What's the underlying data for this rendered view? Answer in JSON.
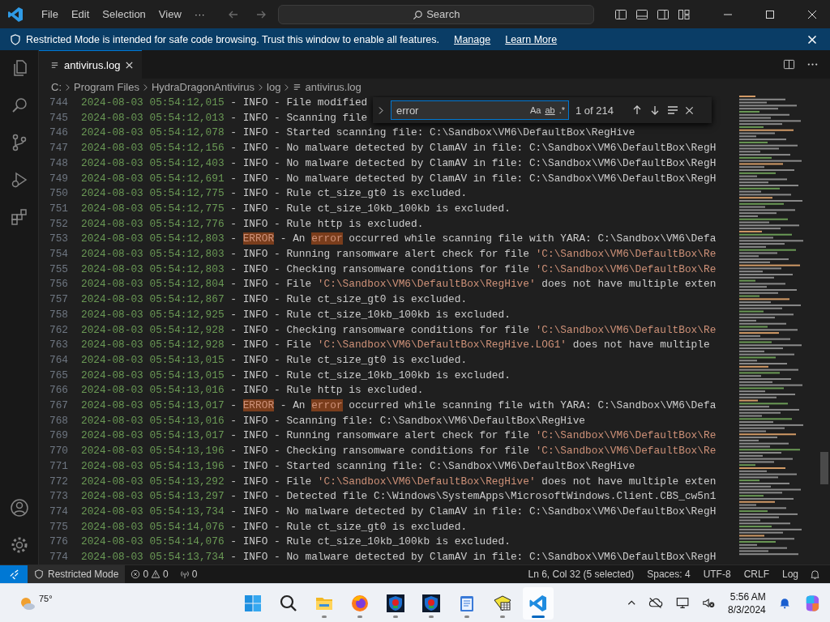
{
  "menu": [
    "File",
    "Edit",
    "Selection",
    "View",
    "···"
  ],
  "search": {
    "placeholder": "Search"
  },
  "banner": {
    "text": "Restricted Mode is intended for safe code browsing. Trust this window to enable all features.",
    "links": [
      "Manage",
      "Learn More"
    ]
  },
  "tabs": [
    {
      "label": "antivirus.log",
      "selected": true
    }
  ],
  "breadcrumb": [
    "C:",
    "Program Files",
    "HydraDragonAntivirus",
    "log",
    "antivirus.log"
  ],
  "find": {
    "value": "error",
    "options": [
      "Aa",
      "ab",
      ".*"
    ],
    "count": "1 of 214"
  },
  "lines": [
    {
      "number": "744",
      "segments": [
        {
          "kind": "time",
          "text": "2024-08-03 05:54:12,015"
        },
        {
          "kind": "plain",
          "text": " - INFO - File modified"
        }
      ]
    },
    {
      "number": "745",
      "segments": [
        {
          "kind": "time",
          "text": "2024-08-03 05:54:12,013"
        },
        {
          "kind": "plain",
          "text": " - INFO - Scanning file"
        }
      ]
    },
    {
      "number": "746",
      "segments": [
        {
          "kind": "time",
          "text": "2024-08-03 05:54:12,078"
        },
        {
          "kind": "plain",
          "text": " - INFO - Started scanning file: C:\\Sandbox\\VM6\\DefaultBox\\RegHive"
        }
      ]
    },
    {
      "number": "747",
      "segments": [
        {
          "kind": "time",
          "text": "2024-08-03 05:54:12,156"
        },
        {
          "kind": "plain",
          "text": " - INFO - No malware detected by ClamAV in file: C:\\Sandbox\\VM6\\DefaultBox\\RegH"
        }
      ]
    },
    {
      "number": "748",
      "segments": [
        {
          "kind": "time",
          "text": "2024-08-03 05:54:12,403"
        },
        {
          "kind": "plain",
          "text": " - INFO - No malware detected by ClamAV in file: C:\\Sandbox\\VM6\\DefaultBox\\RegH"
        }
      ]
    },
    {
      "number": "749",
      "segments": [
        {
          "kind": "time",
          "text": "2024-08-03 05:54:12,691"
        },
        {
          "kind": "plain",
          "text": " - INFO - No malware detected by ClamAV in file: C:\\Sandbox\\VM6\\DefaultBox\\RegH"
        }
      ]
    },
    {
      "number": "750",
      "segments": [
        {
          "kind": "time",
          "text": "2024-08-03 05:54:12,775"
        },
        {
          "kind": "plain",
          "text": " - INFO - Rule ct_size_gt0 is excluded."
        }
      ]
    },
    {
      "number": "751",
      "segments": [
        {
          "kind": "time",
          "text": "2024-08-03 05:54:12,775"
        },
        {
          "kind": "plain",
          "text": " - INFO - Rule ct_size_10kb_100kb is excluded."
        }
      ]
    },
    {
      "number": "752",
      "segments": [
        {
          "kind": "time",
          "text": "2024-08-03 05:54:12,776"
        },
        {
          "kind": "plain",
          "text": " - INFO - Rule http is excluded."
        }
      ]
    },
    {
      "number": "753",
      "segments": [
        {
          "kind": "time",
          "text": "2024-08-03 05:54:12,803"
        },
        {
          "kind": "plain",
          "text": " - "
        },
        {
          "kind": "match",
          "text": "ERROR"
        },
        {
          "kind": "plain",
          "text": " - An "
        },
        {
          "kind": "match",
          "text": "error"
        },
        {
          "kind": "plain",
          "text": " occurred while scanning file with YARA: C:\\Sandbox\\VM6\\Defa"
        }
      ]
    },
    {
      "number": "754",
      "segments": [
        {
          "kind": "time",
          "text": "2024-08-03 05:54:12,803"
        },
        {
          "kind": "plain",
          "text": " - INFO - Running ransomware alert check for file "
        },
        {
          "kind": "string",
          "text": "'C:\\Sandbox\\VM6\\DefaultBox\\Re"
        }
      ]
    },
    {
      "number": "755",
      "segments": [
        {
          "kind": "time",
          "text": "2024-08-03 05:54:12,803"
        },
        {
          "kind": "plain",
          "text": " - INFO - Checking ransomware conditions for file "
        },
        {
          "kind": "string",
          "text": "'C:\\Sandbox\\VM6\\DefaultBox\\Re"
        }
      ]
    },
    {
      "number": "756",
      "segments": [
        {
          "kind": "time",
          "text": "2024-08-03 05:54:12,804"
        },
        {
          "kind": "plain",
          "text": " - INFO - File "
        },
        {
          "kind": "string",
          "text": "'C:\\Sandbox\\VM6\\DefaultBox\\RegHive'"
        },
        {
          "kind": "plain",
          "text": " does not have multiple exten"
        }
      ]
    },
    {
      "number": "757",
      "segments": [
        {
          "kind": "time",
          "text": "2024-08-03 05:54:12,867"
        },
        {
          "kind": "plain",
          "text": " - INFO - Rule ct_size_gt0 is excluded."
        }
      ]
    },
    {
      "number": "758",
      "segments": [
        {
          "kind": "time",
          "text": "2024-08-03 05:54:12,925"
        },
        {
          "kind": "plain",
          "text": " - INFO - Rule ct_size_10kb_100kb is excluded."
        }
      ]
    },
    {
      "number": "762",
      "segments": [
        {
          "kind": "time",
          "text": "2024-08-03 05:54:12,928"
        },
        {
          "kind": "plain",
          "text": " - INFO - Checking ransomware conditions for file "
        },
        {
          "kind": "string",
          "text": "'C:\\Sandbox\\VM6\\DefaultBox\\Re"
        }
      ]
    },
    {
      "number": "763",
      "segments": [
        {
          "kind": "time",
          "text": "2024-08-03 05:54:12,928"
        },
        {
          "kind": "plain",
          "text": " - INFO - File "
        },
        {
          "kind": "string",
          "text": "'C:\\Sandbox\\VM6\\DefaultBox\\RegHive.LOG1'"
        },
        {
          "kind": "plain",
          "text": " does not have multiple"
        }
      ]
    },
    {
      "number": "764",
      "segments": [
        {
          "kind": "time",
          "text": "2024-08-03 05:54:13,015"
        },
        {
          "kind": "plain",
          "text": " - INFO - Rule ct_size_gt0 is excluded."
        }
      ]
    },
    {
      "number": "765",
      "segments": [
        {
          "kind": "time",
          "text": "2024-08-03 05:54:13,015"
        },
        {
          "kind": "plain",
          "text": " - INFO - Rule ct_size_10kb_100kb is excluded."
        }
      ]
    },
    {
      "number": "766",
      "segments": [
        {
          "kind": "time",
          "text": "2024-08-03 05:54:13,016"
        },
        {
          "kind": "plain",
          "text": " - INFO - Rule http is excluded."
        }
      ]
    },
    {
      "number": "767",
      "segments": [
        {
          "kind": "time",
          "text": "2024-08-03 05:54:13,017"
        },
        {
          "kind": "plain",
          "text": " - "
        },
        {
          "kind": "match",
          "text": "ERROR"
        },
        {
          "kind": "plain",
          "text": " - An "
        },
        {
          "kind": "match",
          "text": "error"
        },
        {
          "kind": "plain",
          "text": " occurred while scanning file with YARA: C:\\Sandbox\\VM6\\Defa"
        }
      ]
    },
    {
      "number": "768",
      "segments": [
        {
          "kind": "time",
          "text": "2024-08-03 05:54:13,016"
        },
        {
          "kind": "plain",
          "text": " - INFO - Scanning file: C:\\Sandbox\\VM6\\DefaultBox\\RegHive"
        }
      ]
    },
    {
      "number": "769",
      "segments": [
        {
          "kind": "time",
          "text": "2024-08-03 05:54:13,017"
        },
        {
          "kind": "plain",
          "text": " - INFO - Running ransomware alert check for file "
        },
        {
          "kind": "string",
          "text": "'C:\\Sandbox\\VM6\\DefaultBox\\Re"
        }
      ]
    },
    {
      "number": "770",
      "segments": [
        {
          "kind": "time",
          "text": "2024-08-03 05:54:13,196"
        },
        {
          "kind": "plain",
          "text": " - INFO - Checking ransomware conditions for file "
        },
        {
          "kind": "string",
          "text": "'C:\\Sandbox\\VM6\\DefaultBox\\Re"
        }
      ]
    },
    {
      "number": "771",
      "segments": [
        {
          "kind": "time",
          "text": "2024-08-03 05:54:13,196"
        },
        {
          "kind": "plain",
          "text": " - INFO - Started scanning file: C:\\Sandbox\\VM6\\DefaultBox\\RegHive"
        }
      ]
    },
    {
      "number": "772",
      "segments": [
        {
          "kind": "time",
          "text": "2024-08-03 05:54:13,292"
        },
        {
          "kind": "plain",
          "text": " - INFO - File "
        },
        {
          "kind": "string",
          "text": "'C:\\Sandbox\\VM6\\DefaultBox\\RegHive'"
        },
        {
          "kind": "plain",
          "text": " does not have multiple exten"
        }
      ]
    },
    {
      "number": "773",
      "segments": [
        {
          "kind": "time",
          "text": "2024-08-03 05:54:13,297"
        },
        {
          "kind": "plain",
          "text": " - INFO - Detected file C:\\Windows\\SystemApps\\MicrosoftWindows.Client.CBS_cw5n1"
        }
      ]
    },
    {
      "number": "774",
      "segments": [
        {
          "kind": "time",
          "text": "2024-08-03 05:54:13,734"
        },
        {
          "kind": "plain",
          "text": " - INFO - No malware detected by ClamAV in file: C:\\Sandbox\\VM6\\DefaultBox\\RegH"
        }
      ]
    },
    {
      "number": "775",
      "segments": [
        {
          "kind": "time",
          "text": "2024-08-03 05:54:14,076"
        },
        {
          "kind": "plain",
          "text": " - INFO - Rule ct_size_gt0 is excluded."
        }
      ]
    },
    {
      "number": "776",
      "segments": [
        {
          "kind": "time",
          "text": "2024-08-03 05:54:14,076"
        },
        {
          "kind": "plain",
          "text": " - INFO - Rule ct_size_10kb_100kb is excluded."
        }
      ]
    },
    {
      "number": "774",
      "segments": [
        {
          "kind": "time",
          "text": "2024-08-03 05:54:13,734"
        },
        {
          "kind": "plain",
          "text": " - INFO - No malware detected by ClamAV in file: C:\\Sandbox\\VM6\\DefaultBox\\RegH"
        }
      ]
    }
  ],
  "status_bar": {
    "restricted": "Restricted Mode",
    "errors": "0",
    "warnings": "0",
    "ports": "0",
    "items": [
      "Ln 6, Col 32 (5 selected)",
      "Spaces: 4",
      "UTF-8",
      "CRLF",
      "Log"
    ]
  },
  "taskbar": {
    "weather": "75°",
    "apps": [
      {
        "kind": "start",
        "active": false
      },
      {
        "kind": "search",
        "active": false
      },
      {
        "kind": "folder",
        "active": false
      },
      {
        "kind": "browser",
        "active": false
      },
      {
        "kind": "shield",
        "active": false
      },
      {
        "kind": "shield",
        "active": false
      },
      {
        "kind": "notepad",
        "active": false
      },
      {
        "kind": "sheet",
        "active": false
      },
      {
        "kind": "code",
        "active": true
      }
    ],
    "time": "5:56 AM",
    "date": "8/3/2024"
  }
}
